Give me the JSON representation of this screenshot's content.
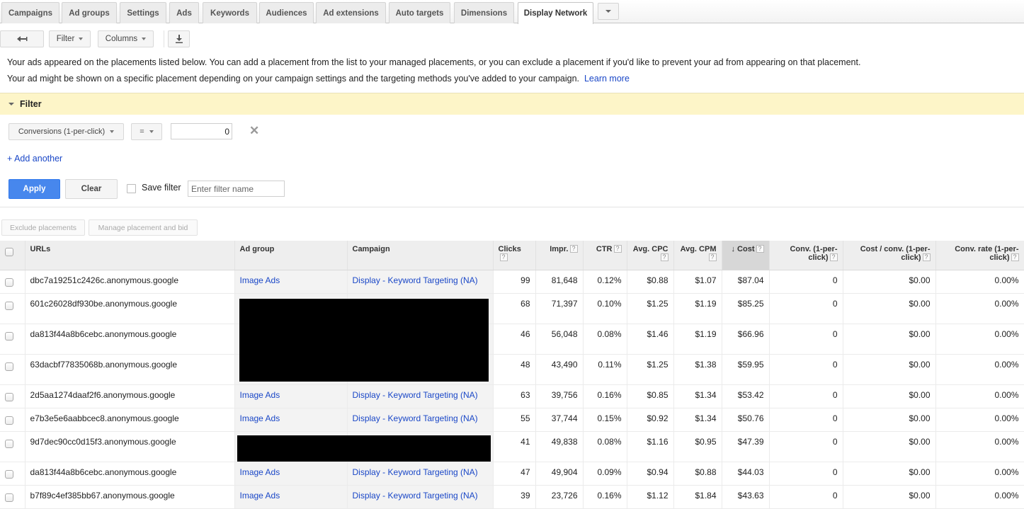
{
  "tabs": [
    {
      "label": "Campaigns",
      "active": false
    },
    {
      "label": "Ad groups",
      "active": false
    },
    {
      "label": "Settings",
      "active": false
    },
    {
      "label": "Ads",
      "active": false
    },
    {
      "label": "Keywords",
      "active": false
    },
    {
      "label": "Audiences",
      "active": false
    },
    {
      "label": "Ad extensions",
      "active": false
    },
    {
      "label": "Auto targets",
      "active": false
    },
    {
      "label": "Dimensions",
      "active": false
    },
    {
      "label": "Display Network",
      "active": true
    }
  ],
  "toolbar": {
    "back_icon": "back-arrow-icon",
    "filter_label": "Filter",
    "columns_label": "Columns",
    "download_icon": "download-icon"
  },
  "intro": {
    "line1": "Your ads appeared on the placements listed below. You can add a placement from the list to your managed placements, or you can exclude a placement if you'd like to prevent your ad from appearing on that placement.",
    "line2": "Your ad might be shown on a specific placement depending on your campaign settings and the targeting methods you've added to your campaign.",
    "learn_more": "Learn more"
  },
  "filter": {
    "title": "Filter",
    "metric": "Conversions (1-per-click)",
    "operator": "=",
    "value": "0",
    "add_another": "+ Add another",
    "apply": "Apply",
    "clear": "Clear",
    "save_filter_label": "Save filter",
    "save_filter_checked": false,
    "filter_name_placeholder": "Enter filter name"
  },
  "actions": {
    "exclude": "Exclude placements",
    "manage": "Manage placement and bid"
  },
  "table": {
    "columns": [
      {
        "label": "URLs",
        "help": false
      },
      {
        "label": "Ad group",
        "help": false
      },
      {
        "label": "Campaign",
        "help": false
      },
      {
        "label": "Clicks",
        "help": true
      },
      {
        "label": "Impr.",
        "help": true
      },
      {
        "label": "CTR",
        "help": true
      },
      {
        "label": "Avg. CPC",
        "help": true
      },
      {
        "label": "Avg. CPM",
        "help": true
      },
      {
        "label": "Cost",
        "help": true,
        "sorted": "descending"
      },
      {
        "label": "Conv. (1-per-click)",
        "help": true
      },
      {
        "label": "Cost / conv. (1-per-click)",
        "help": true
      },
      {
        "label": "Conv. rate (1-per-click)",
        "help": true
      }
    ],
    "rows": [
      {
        "url": "dbc7a19251c2426c.anonymous.google",
        "ad_group": "Image Ads",
        "campaign": "Display - Keyword Targeting (NA)",
        "clicks": "99",
        "impr": "81,648",
        "ctr": "0.12%",
        "avg_cpc": "$0.88",
        "avg_cpm": "$1.07",
        "cost": "$87.04",
        "conv": "0",
        "cost_conv": "$0.00",
        "conv_rate": "0.00%"
      },
      {
        "url": "601c26028df930be.anonymous.google",
        "ad_group": "",
        "campaign": "",
        "clicks": "68",
        "impr": "71,397",
        "ctr": "0.10%",
        "avg_cpc": "$1.25",
        "avg_cpm": "$1.19",
        "cost": "$85.25",
        "conv": "0",
        "cost_conv": "$0.00",
        "conv_rate": "0.00%"
      },
      {
        "url": "da813f44a8b6cebc.anonymous.google",
        "ad_group": "",
        "campaign": "",
        "clicks": "46",
        "impr": "56,048",
        "ctr": "0.08%",
        "avg_cpc": "$1.46",
        "avg_cpm": "$1.19",
        "cost": "$66.96",
        "conv": "0",
        "cost_conv": "$0.00",
        "conv_rate": "0.00%"
      },
      {
        "url": "63dacbf77835068b.anonymous.google",
        "ad_group": "",
        "campaign": "",
        "clicks": "48",
        "impr": "43,490",
        "ctr": "0.11%",
        "avg_cpc": "$1.25",
        "avg_cpm": "$1.38",
        "cost": "$59.95",
        "conv": "0",
        "cost_conv": "$0.00",
        "conv_rate": "0.00%"
      },
      {
        "url": "2d5aa1274daaf2f6.anonymous.google",
        "ad_group": "Image Ads",
        "campaign": "Display - Keyword Targeting (NA)",
        "clicks": "63",
        "impr": "39,756",
        "ctr": "0.16%",
        "avg_cpc": "$0.85",
        "avg_cpm": "$1.34",
        "cost": "$53.42",
        "conv": "0",
        "cost_conv": "$0.00",
        "conv_rate": "0.00%"
      },
      {
        "url": "e7b3e5e6aabbcec8.anonymous.google",
        "ad_group": "Image Ads",
        "campaign": "Display - Keyword Targeting (NA)",
        "clicks": "55",
        "impr": "37,744",
        "ctr": "0.15%",
        "avg_cpc": "$0.92",
        "avg_cpm": "$1.34",
        "cost": "$50.76",
        "conv": "0",
        "cost_conv": "$0.00",
        "conv_rate": "0.00%"
      },
      {
        "url": "9d7dec90cc0d15f3.anonymous.google",
        "ad_group": "",
        "campaign": "",
        "clicks": "41",
        "impr": "49,838",
        "ctr": "0.08%",
        "avg_cpc": "$1.16",
        "avg_cpm": "$0.95",
        "cost": "$47.39",
        "conv": "0",
        "cost_conv": "$0.00",
        "conv_rate": "0.00%"
      },
      {
        "url": "da813f44a8b6cebc.anonymous.google",
        "ad_group": "Image Ads",
        "campaign": "Display - Keyword Targeting (NA)",
        "clicks": "47",
        "impr": "49,904",
        "ctr": "0.09%",
        "avg_cpc": "$0.94",
        "avg_cpm": "$0.88",
        "cost": "$44.03",
        "conv": "0",
        "cost_conv": "$0.00",
        "conv_rate": "0.00%"
      },
      {
        "url": "b7f89c4ef385bb67.anonymous.google",
        "ad_group": "Image Ads",
        "campaign": "Display - Keyword Targeting (NA)",
        "clicks": "39",
        "impr": "23,726",
        "ctr": "0.16%",
        "avg_cpc": "$1.12",
        "avg_cpm": "$1.84",
        "cost": "$43.63",
        "conv": "0",
        "cost_conv": "$0.00",
        "conv_rate": "0.00%"
      }
    ]
  },
  "colors": {
    "link": "#1a47c7",
    "apply_button": "#4787ed",
    "filter_bar": "#fdf5c8",
    "sorted_header": "#d7d7d7"
  }
}
